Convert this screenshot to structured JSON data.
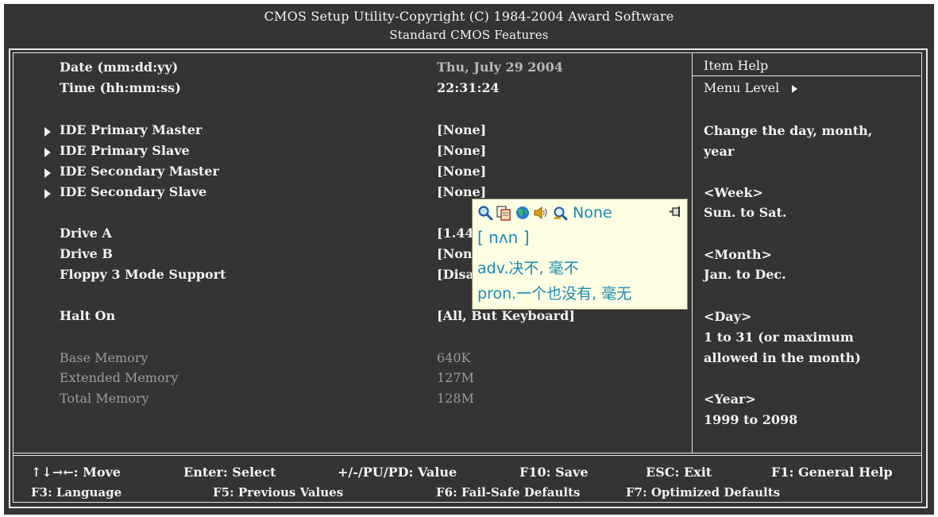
{
  "header": {
    "title": "CMOS Setup Utility-Copyright (C) 1984-2004 Award Software",
    "subtitle": "Standard CMOS Features"
  },
  "settings": {
    "date_label": "Date (mm:dd:yy)",
    "date_value": "Thu, July  29 2004",
    "time_label": "Time (hh:mm:ss)",
    "time_value": "22:31:24",
    "ide_pm_label": "IDE Primary Master",
    "ide_pm_value": "[None]",
    "ide_ps_label": "IDE Primary Slave",
    "ide_ps_value": "[None]",
    "ide_sm_label": "IDE Secondary Master",
    "ide_sm_value": "[None]",
    "ide_ss_label": "IDE Secondary Slave",
    "ide_ss_value": "[None]",
    "drive_a_label": "Drive A",
    "drive_a_value": "[1.44",
    "drive_b_label": "Drive B",
    "drive_b_value": "[Non",
    "floppy_label": "Floppy 3 Mode Support",
    "floppy_value": "[Disa",
    "halt_label": "Halt On",
    "halt_value": "[All, But Keyboard]",
    "base_mem_label": "Base Memory",
    "base_mem_value": "640K",
    "ext_mem_label": "Extended Memory",
    "ext_mem_value": "127M",
    "total_mem_label": "Total Memory",
    "total_mem_value": "128M"
  },
  "help": {
    "title": "Item Help",
    "menu_level": "Menu Level",
    "line1": "Change the day, month,",
    "line2": "year",
    "week_h": "<Week>",
    "week_v": "Sun. to Sat.",
    "month_h": "<Month>",
    "month_v": "Jan. to Dec.",
    "day_h": "<Day>",
    "day_v1": "1 to 31 (or maximum",
    "day_v2": "allowed in the month)",
    "year_h": "<Year>",
    "year_v": "1999 to 2098"
  },
  "footer": {
    "move": "↑↓→←: Move",
    "enter": "Enter: Select",
    "value": "+/-/PU/PD: Value",
    "save": "F10: Save",
    "esc": "ESC: Exit",
    "help": "F1: General Help",
    "language": "F3: Language",
    "prev": "F5: Previous Values",
    "failsafe": "F6: Fail-Safe Defaults",
    "optimized": "F7: Optimized Defaults"
  },
  "popup": {
    "word": "None",
    "phonetic": "[ nʌn ]",
    "def1": "adv.决不, 毫不",
    "def2": "pron.一个也没有, 毫无",
    "icons": [
      "search-icon",
      "copy-icon",
      "globe-icon",
      "speaker-icon",
      "lookup-icon",
      "pin-icon"
    ]
  }
}
